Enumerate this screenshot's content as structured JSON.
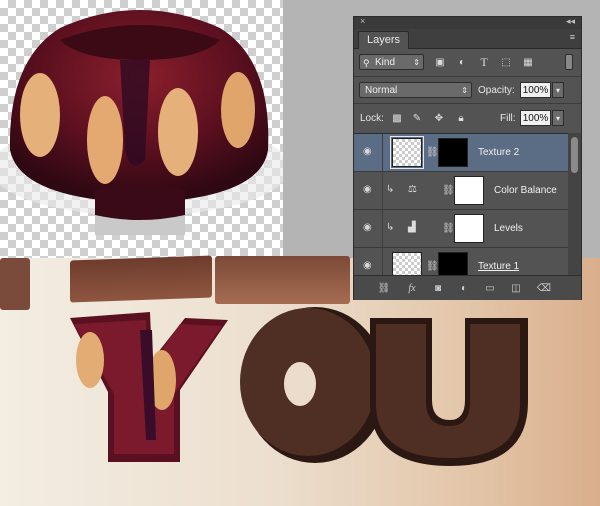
{
  "panel": {
    "close_icon": "×",
    "collapse_icon": "◂◂",
    "tab_label": "Layers",
    "menu_icon": "≡"
  },
  "filter": {
    "kind_label": "Kind",
    "icons": [
      "image-filter-icon",
      "adjustment-filter-icon",
      "type-filter-icon",
      "shape-filter-icon",
      "smart-object-filter-icon"
    ]
  },
  "blend": {
    "mode": "Normal",
    "opacity_label": "Opacity:",
    "opacity_value": "100%"
  },
  "lock": {
    "label": "Lock:",
    "fill_label": "Fill:",
    "fill_value": "100%"
  },
  "layers": [
    {
      "name": "Texture 2",
      "selected": true,
      "type": "pixel-with-mask"
    },
    {
      "name": "Color Balance",
      "selected": false,
      "type": "adjustment",
      "clipped": true
    },
    {
      "name": "Levels",
      "selected": false,
      "type": "adjustment",
      "clipped": true
    },
    {
      "name": "Texture 1",
      "selected": false,
      "type": "pixel-with-mask"
    }
  ],
  "colors": {
    "panel_bg": "#535353",
    "selected_row": "#5b6c85",
    "letter_brown": "#4f2e24"
  }
}
